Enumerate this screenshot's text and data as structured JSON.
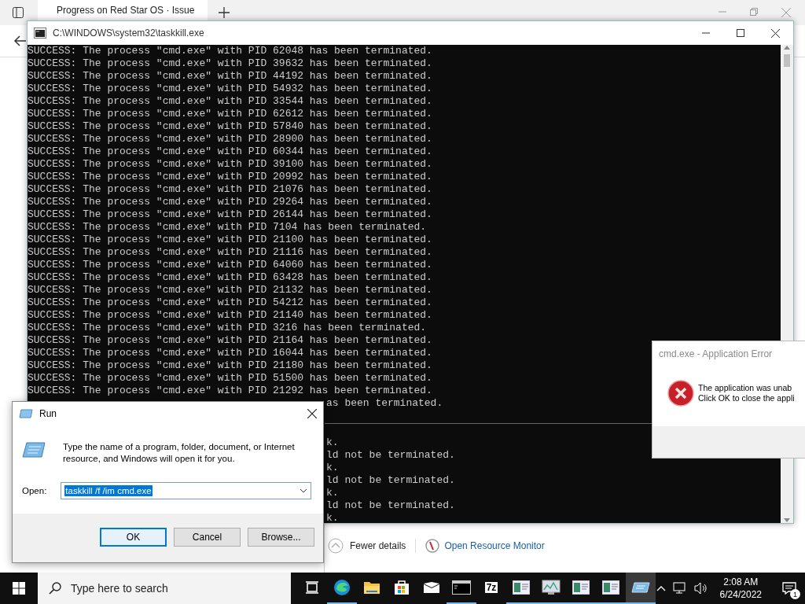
{
  "browser": {
    "tab": {
      "title": "Progress on Red Star OS · Issue"
    }
  },
  "console_window": {
    "title": "C:\\WINDOWS\\system32\\taskkill.exe",
    "lines": [
      {
        "kind": "full",
        "text": "SUCCESS: The process \"cmd.exe\" with PID 62048 has been terminated."
      },
      {
        "kind": "full",
        "text": "SUCCESS: The process \"cmd.exe\" with PID 39632 has been terminated."
      },
      {
        "kind": "full",
        "text": "SUCCESS: The process \"cmd.exe\" with PID 44192 has been terminated."
      },
      {
        "kind": "full",
        "text": "SUCCESS: The process \"cmd.exe\" with PID 54932 has been terminated."
      },
      {
        "kind": "full",
        "text": "SUCCESS: The process \"cmd.exe\" with PID 33544 has been terminated."
      },
      {
        "kind": "full",
        "text": "SUCCESS: The process \"cmd.exe\" with PID 62612 has been terminated."
      },
      {
        "kind": "full",
        "text": "SUCCESS: The process \"cmd.exe\" with PID 57840 has been terminated."
      },
      {
        "kind": "full",
        "text": "SUCCESS: The process \"cmd.exe\" with PID 28900 has been terminated."
      },
      {
        "kind": "full",
        "text": "SUCCESS: The process \"cmd.exe\" with PID 60344 has been terminated."
      },
      {
        "kind": "full",
        "text": "SUCCESS: The process \"cmd.exe\" with PID 39100 has been terminated."
      },
      {
        "kind": "full",
        "text": "SUCCESS: The process \"cmd.exe\" with PID 20992 has been terminated."
      },
      {
        "kind": "full",
        "text": "SUCCESS: The process \"cmd.exe\" with PID 21076 has been terminated."
      },
      {
        "kind": "full",
        "text": "SUCCESS: The process \"cmd.exe\" with PID 29264 has been terminated."
      },
      {
        "kind": "full",
        "text": "SUCCESS: The process \"cmd.exe\" with PID 26144 has been terminated."
      },
      {
        "kind": "full",
        "text": "SUCCESS: The process \"cmd.exe\" with PID 7104 has been terminated."
      },
      {
        "kind": "full",
        "text": "SUCCESS: The process \"cmd.exe\" with PID 21100 has been terminated."
      },
      {
        "kind": "full",
        "text": "SUCCESS: The process \"cmd.exe\" with PID 21116 has been terminated."
      },
      {
        "kind": "full",
        "text": "SUCCESS: The process \"cmd.exe\" with PID 64060 has been terminated."
      },
      {
        "kind": "full",
        "text": "SUCCESS: The process \"cmd.exe\" with PID 63428 has been terminated."
      },
      {
        "kind": "full",
        "text": "SUCCESS: The process \"cmd.exe\" with PID 21132 has been terminated."
      },
      {
        "kind": "full",
        "text": "SUCCESS: The process \"cmd.exe\" with PID 54212 has been terminated."
      },
      {
        "kind": "full",
        "text": "SUCCESS: The process \"cmd.exe\" with PID 21140 has been terminated."
      },
      {
        "kind": "full",
        "text": "SUCCESS: The process \"cmd.exe\" with PID 3216 has been terminated."
      },
      {
        "kind": "full",
        "text": "SUCCESS: The process \"cmd.exe\" with PID 21164 has been terminated."
      },
      {
        "kind": "full",
        "text": "SUCCESS: The process \"cmd.exe\" with PID 16044 has been terminated."
      },
      {
        "kind": "full",
        "text": "SUCCESS: The process \"cmd.exe\" with PID 21180 has been terminated."
      },
      {
        "kind": "full",
        "text": "SUCCESS: The process \"cmd.exe\" with PID 51500 has been terminated."
      },
      {
        "kind": "full",
        "text": "SUCCESS: The process \"cmd.exe\" with PID 21292 has been terminated."
      },
      {
        "kind": "clipped",
        "text": "as been terminated."
      },
      {
        "kind": "divider"
      },
      {
        "kind": "clipped",
        "text": "k."
      },
      {
        "kind": "clipped",
        "text": "ld not be terminated."
      },
      {
        "kind": "clipped",
        "text": "k."
      },
      {
        "kind": "clipped",
        "text": "ld not be terminated."
      },
      {
        "kind": "clipped",
        "text": "k."
      },
      {
        "kind": "clipped",
        "text": "ld not be terminated."
      },
      {
        "kind": "clipped",
        "text": "k."
      }
    ]
  },
  "task_manager": {
    "toggle": "Fewer details",
    "link": "Open Resource Monitor"
  },
  "error_dialog": {
    "title": "cmd.exe - Application Error",
    "message": [
      "The application was unab",
      "Click OK to close the appli"
    ]
  },
  "run_dialog": {
    "title": "Run",
    "description": "Type the name of a program, folder, document, or Internet resource, and Windows will open it for you.",
    "open_label": "Open:",
    "command": {
      "value": "taskkill /f /im cmd.exe",
      "selected": true
    },
    "buttons": [
      {
        "label": "OK",
        "default": true
      },
      {
        "label": "Cancel",
        "default": false
      },
      {
        "label": "Browse...",
        "default": false
      }
    ]
  },
  "taskbar": {
    "search_placeholder": "Type here to search",
    "apps": [
      {
        "kind": "task-view",
        "running": false,
        "selected": false
      },
      {
        "kind": "edge",
        "running": true,
        "selected": false
      },
      {
        "kind": "folder",
        "running": false,
        "selected": false
      },
      {
        "kind": "store",
        "running": false,
        "selected": false
      },
      {
        "kind": "mail",
        "running": false,
        "selected": false
      },
      {
        "kind": "terminal",
        "running": true,
        "selected": false
      },
      {
        "kind": "archiver",
        "label": "7z",
        "running": false,
        "selected": false
      },
      {
        "kind": "window",
        "running": true,
        "selected": false
      },
      {
        "kind": "monitor",
        "running": true,
        "selected": false
      },
      {
        "kind": "window",
        "running": true,
        "selected": false
      },
      {
        "kind": "window",
        "running": true,
        "selected": false
      },
      {
        "kind": "run",
        "running": true,
        "selected": true
      }
    ],
    "time": "2:08 AM",
    "date": "6/24/2022",
    "notification_count": "1"
  }
}
